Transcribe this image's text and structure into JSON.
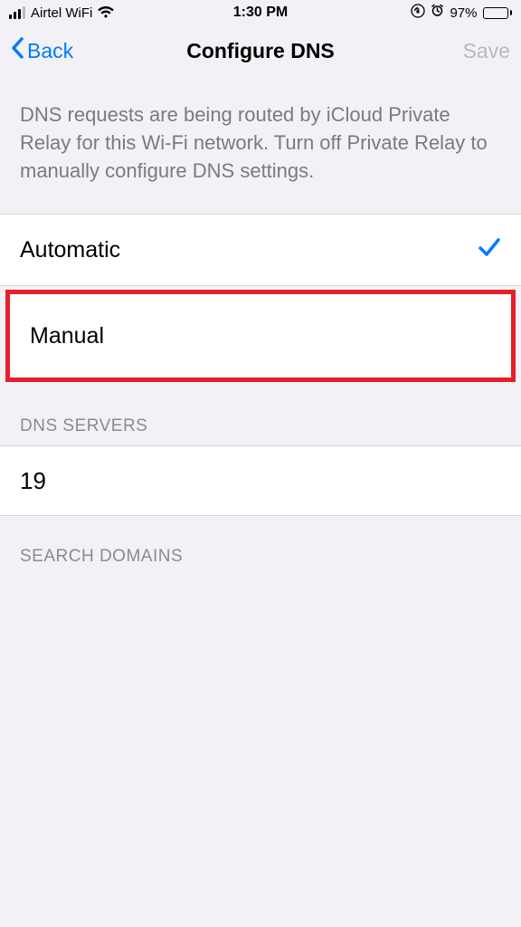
{
  "status": {
    "carrier": "Airtel WiFi",
    "time": "1:30 PM",
    "battery_pct": "97%"
  },
  "nav": {
    "back": "Back",
    "title": "Configure DNS",
    "save": "Save"
  },
  "description": "DNS requests are being routed by iCloud Private Relay for this Wi-Fi network. Turn off Private Relay to manually configure DNS settings.",
  "options": {
    "automatic": "Automatic",
    "manual": "Manual",
    "selected": "automatic"
  },
  "sections": {
    "dns_servers": "DNS SERVERS",
    "search_domains": "SEARCH DOMAINS"
  },
  "dns_servers": [
    "19"
  ]
}
